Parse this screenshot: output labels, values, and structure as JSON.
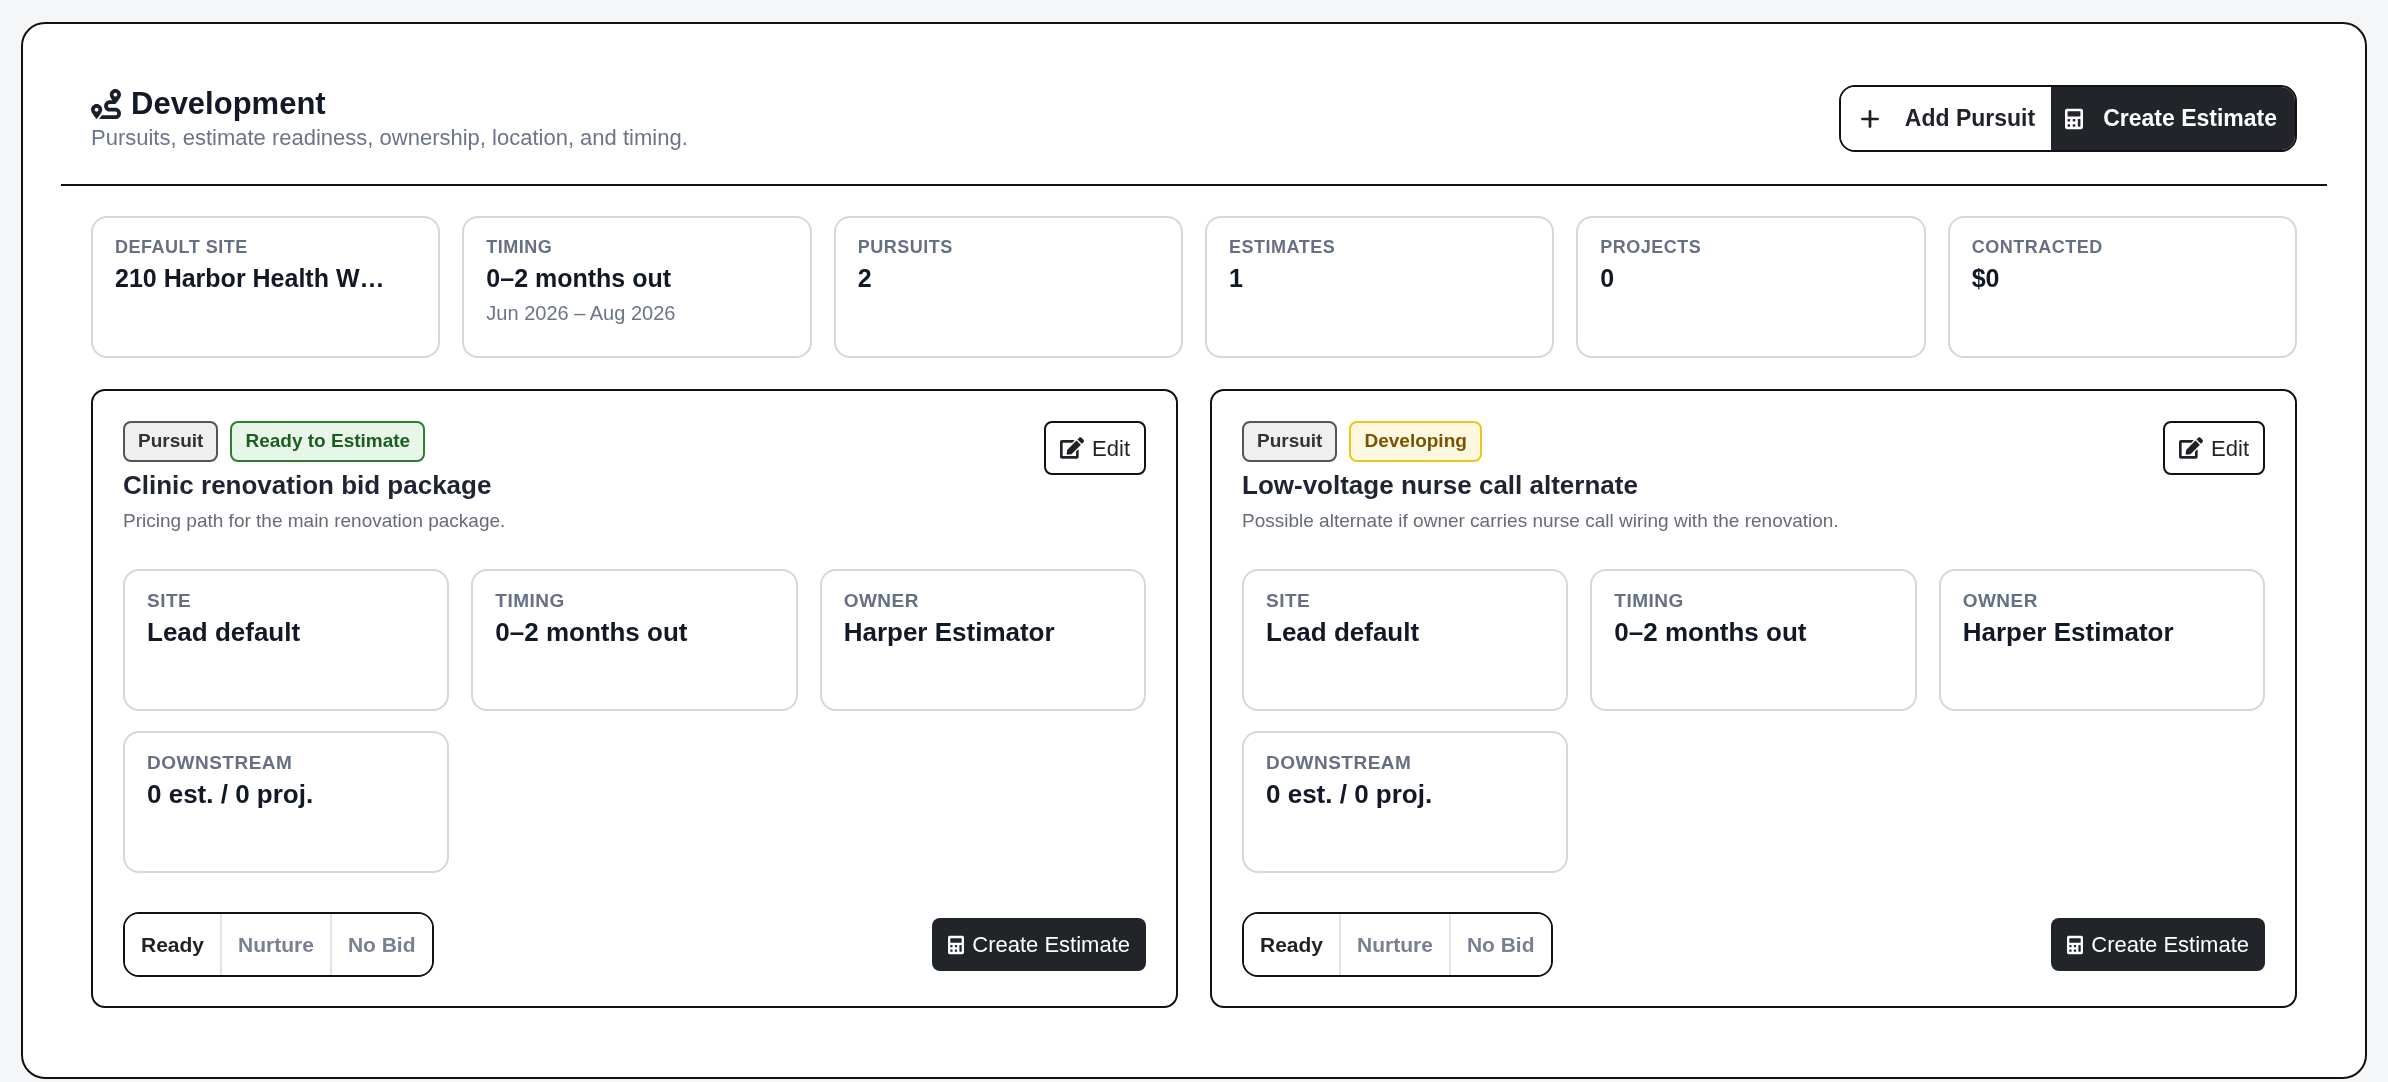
{
  "header": {
    "title": "Development",
    "subtitle": "Pursuits, estimate readiness, ownership, location, and timing."
  },
  "actions": [
    {
      "kind": "add",
      "label": "Add Pursuit"
    },
    {
      "kind": "estimate",
      "label": "Create Estimate"
    }
  ],
  "stats": [
    {
      "label": "DEFAULT SITE",
      "value": "210 Harbor Health W…"
    },
    {
      "label": "TIMING",
      "value": "0–2 months out",
      "detail": "Jun 2026 – Aug 2026"
    },
    {
      "label": "PURSUITS",
      "value": "2"
    },
    {
      "label": "ESTIMATES",
      "value": "1"
    },
    {
      "label": "PROJECTS",
      "value": "0"
    },
    {
      "label": "CONTRACTED",
      "value": "$0"
    }
  ],
  "pursuits": [
    {
      "badges": [
        {
          "kind": "neutral",
          "label": "Pursuit"
        },
        {
          "kind": "success",
          "label": "Ready to Estimate"
        }
      ],
      "edit_label": "Edit",
      "title": "Clinic renovation bid package",
      "description": "Pricing path for the main renovation package.",
      "fields": [
        {
          "label": "SITE",
          "value": "Lead default"
        },
        {
          "label": "TIMING",
          "value": "0–2 months out"
        },
        {
          "label": "OWNER",
          "value": "Harper Estimator"
        },
        {
          "label": "DOWNSTREAM",
          "value": "0 est. / 0 proj."
        }
      ],
      "status_options": [
        {
          "label": "Ready",
          "selected": true
        },
        {
          "label": "Nurture",
          "selected": false
        },
        {
          "label": "No Bid",
          "selected": false
        }
      ],
      "create_label": "Create Estimate"
    },
    {
      "badges": [
        {
          "kind": "neutral",
          "label": "Pursuit"
        },
        {
          "kind": "warning",
          "label": "Developing"
        }
      ],
      "edit_label": "Edit",
      "title": "Low-voltage nurse call alternate",
      "description": "Possible alternate if owner carries nurse call wiring with the renovation.",
      "fields": [
        {
          "label": "SITE",
          "value": "Lead default"
        },
        {
          "label": "TIMING",
          "value": "0–2 months out"
        },
        {
          "label": "OWNER",
          "value": "Harper Estimator"
        },
        {
          "label": "DOWNSTREAM",
          "value": "0 est. / 0 proj."
        }
      ],
      "status_options": [
        {
          "label": "Ready",
          "selected": true
        },
        {
          "label": "Nurture",
          "selected": false
        },
        {
          "label": "No Bid",
          "selected": false
        }
      ],
      "create_label": "Create Estimate"
    }
  ]
}
